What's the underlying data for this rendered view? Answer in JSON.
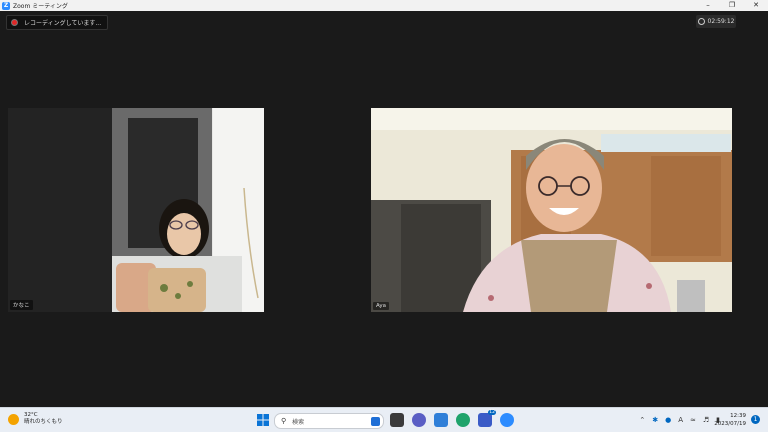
{
  "window": {
    "title": "Zoom ミーティング",
    "logo_letter": "Z"
  },
  "recording": {
    "text": "レコーディングしています..."
  },
  "timer": {
    "value": "02:59:12"
  },
  "participants": [
    {
      "name": "かなこ"
    },
    {
      "name": "Aya"
    }
  ],
  "taskbar": {
    "weather": {
      "temp": "32°C",
      "condition": "晴れのちくもり"
    },
    "search_label": "検索",
    "teams_badge": "12",
    "clock_time": "12:39",
    "clock_date": "2023/07/19",
    "notification_count": "1",
    "ime_letter": "A"
  }
}
